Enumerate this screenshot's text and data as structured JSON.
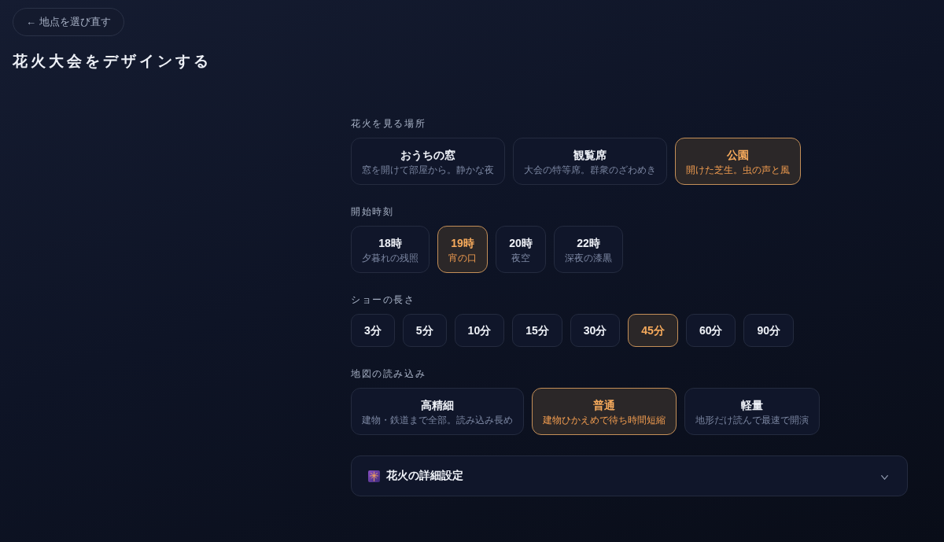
{
  "back_button": {
    "label": "← 地点を選び直す"
  },
  "title": "花火大会をデザインする",
  "sections": [
    {
      "label": "花火を見る場所",
      "kind": "cards",
      "options": [
        {
          "title": "おうちの窓",
          "description": "窓を開けて部屋から。静かな夜",
          "selected": false
        },
        {
          "title": "観覧席",
          "description": "大会の特等席。群衆のざわめき",
          "selected": false
        },
        {
          "title": "公園",
          "description": "開けた芝生。虫の声と風",
          "selected": true
        }
      ]
    },
    {
      "label": "開始時刻",
      "kind": "cards",
      "options": [
        {
          "title": "18時",
          "description": "夕暮れの残照",
          "selected": false
        },
        {
          "title": "19時",
          "description": "宵の口",
          "selected": true
        },
        {
          "title": "20時",
          "description": "夜空",
          "selected": false
        },
        {
          "title": "22時",
          "description": "深夜の漆黒",
          "selected": false
        }
      ]
    },
    {
      "label": "ショーの長さ",
      "kind": "chips",
      "options": [
        {
          "title": "3分",
          "selected": false
        },
        {
          "title": "5分",
          "selected": false
        },
        {
          "title": "10分",
          "selected": false
        },
        {
          "title": "15分",
          "selected": false
        },
        {
          "title": "30分",
          "selected": false
        },
        {
          "title": "45分",
          "selected": true
        },
        {
          "title": "60分",
          "selected": false
        },
        {
          "title": "90分",
          "selected": false
        }
      ]
    },
    {
      "label": "地図の読み込み",
      "kind": "cards",
      "options": [
        {
          "title": "高精細",
          "description": "建物・鉄道まで全部。読み込み長め",
          "selected": false
        },
        {
          "title": "普通",
          "description": "建物ひかえめで待ち時間短縮",
          "selected": true
        },
        {
          "title": "軽量",
          "description": "地形だけ読んで最速で開演",
          "selected": false
        }
      ]
    }
  ],
  "details": {
    "label": "花火の詳細設定",
    "expanded": false
  }
}
